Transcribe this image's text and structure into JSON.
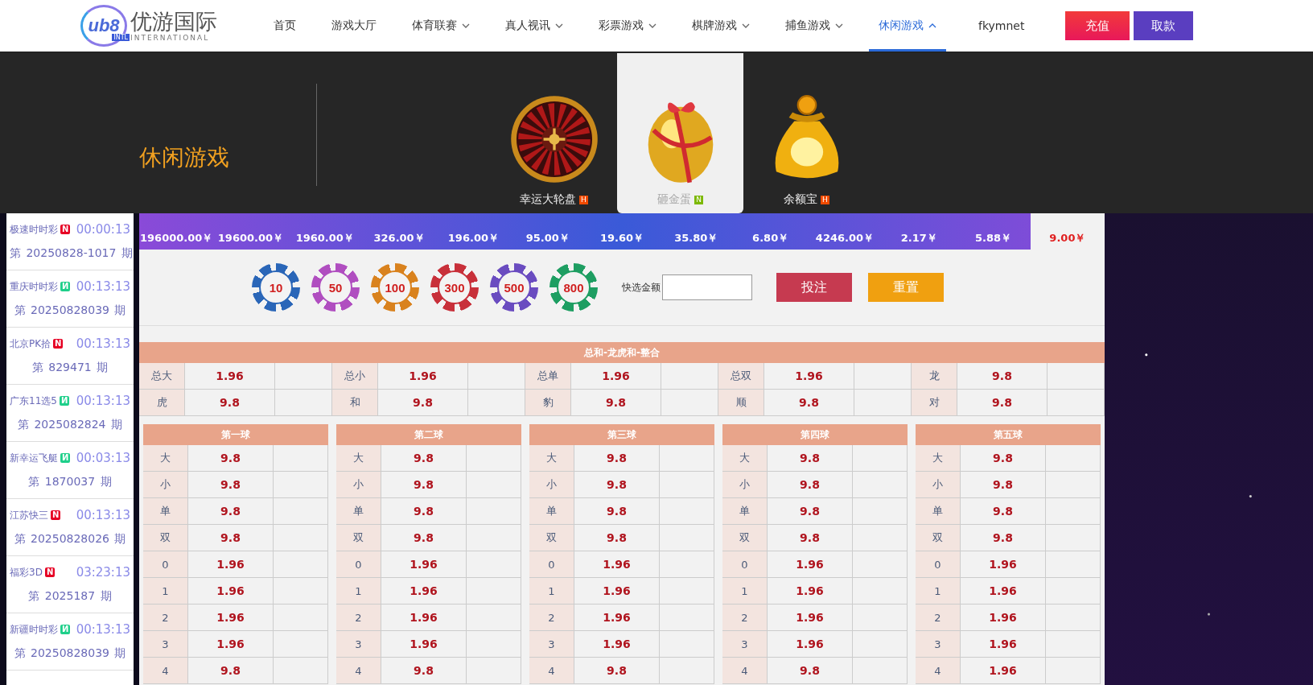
{
  "header": {
    "logo": {
      "mark": "ub8",
      "tag": "INTL",
      "name": "优游国际",
      "sub": "INTERNATIONAL"
    },
    "nav": [
      {
        "label": "首页",
        "dropdown": false,
        "expanded": false,
        "selected": false
      },
      {
        "label": "游戏大厅",
        "dropdown": false,
        "expanded": false,
        "selected": false
      },
      {
        "label": "体育联赛",
        "dropdown": true,
        "expanded": false,
        "selected": false
      },
      {
        "label": "真人视讯",
        "dropdown": true,
        "expanded": false,
        "selected": false
      },
      {
        "label": "彩票游戏",
        "dropdown": true,
        "expanded": false,
        "selected": false
      },
      {
        "label": "棋牌游戏",
        "dropdown": true,
        "expanded": false,
        "selected": false
      },
      {
        "label": "捕鱼游戏",
        "dropdown": true,
        "expanded": false,
        "selected": false
      },
      {
        "label": "休闲游戏",
        "dropdown": true,
        "expanded": true,
        "selected": true
      }
    ],
    "user": "fkymnet",
    "buttons": [
      {
        "label": "充值",
        "kind": "deposit"
      },
      {
        "label": "取款",
        "kind": "withdraw"
      }
    ]
  },
  "dropdown": {
    "title": "休闲游戏",
    "items": [
      {
        "label": "幸运大轮盘",
        "badge": "H",
        "kind": "wheel",
        "selected": false
      },
      {
        "label": "砸金蛋",
        "badge": "N",
        "kind": "egg",
        "selected": true
      },
      {
        "label": "余额宝",
        "badge": "H",
        "kind": "bag",
        "selected": false
      }
    ]
  },
  "sidebar": {
    "items": [
      {
        "name": "极速时时彩",
        "badge": "N",
        "color": "#e60023",
        "time": "00:00:13",
        "issue": "第 20250828-1017 期"
      },
      {
        "name": "重庆时时彩",
        "badge": "И",
        "color": "#1ecf8a",
        "time": "00:13:13",
        "issue": "第 20250828039 期"
      },
      {
        "name": "北京PK拾",
        "badge": "N",
        "color": "#e60023",
        "time": "00:13:13",
        "issue": "第 829471 期"
      },
      {
        "name": "广东11选5",
        "badge": "И",
        "color": "#1ecf8a",
        "time": "00:13:13",
        "issue": "第 2025082824 期"
      },
      {
        "name": "新幸运飞艇",
        "badge": "И",
        "color": "#1ecf8a",
        "time": "00:03:13",
        "issue": "第 1870037 期"
      },
      {
        "name": "江苏快三",
        "badge": "N",
        "color": "#e60023",
        "time": "00:13:13",
        "issue": "第 20250828026 期"
      },
      {
        "name": "福彩3D",
        "badge": "N",
        "color": "#e60023",
        "time": "03:23:13",
        "issue": "第 2025187 期"
      },
      {
        "name": "新疆时时彩",
        "badge": "И",
        "color": "#1ecf8a",
        "time": "00:13:13",
        "issue": "第 20250828039 期"
      }
    ]
  },
  "prizes": [
    {
      "value": "196000.00￥",
      "selected": false
    },
    {
      "value": "19600.00￥",
      "selected": false
    },
    {
      "value": "1960.00￥",
      "selected": false
    },
    {
      "value": "326.00￥",
      "selected": false
    },
    {
      "value": "196.00￥",
      "selected": false
    },
    {
      "value": "95.00￥",
      "selected": false
    },
    {
      "value": "19.60￥",
      "selected": false
    },
    {
      "value": "35.80￥",
      "selected": false
    },
    {
      "value": "6.80￥",
      "selected": false
    },
    {
      "value": "4246.00￥",
      "selected": false
    },
    {
      "value": "2.17￥",
      "selected": false
    },
    {
      "value": "5.88￥",
      "selected": false
    },
    {
      "value": "9.00￥",
      "selected": true
    }
  ],
  "chips": [
    {
      "label": "10",
      "color": "#2a66b8"
    },
    {
      "label": "50",
      "color": "#b04ec0"
    },
    {
      "label": "100",
      "color": "#d9821e"
    },
    {
      "label": "300",
      "color": "#c8303a"
    },
    {
      "label": "500",
      "color": "#6a4cc0"
    },
    {
      "label": "800",
      "color": "#1e9e62"
    }
  ],
  "quick_amount": {
    "label": "快选金额"
  },
  "actions": [
    {
      "label": "投注",
      "kind": "bet"
    },
    {
      "label": "重置",
      "kind": "reset"
    }
  ],
  "summary": {
    "title": "总和-龙虎和-整合",
    "rows": [
      [
        {
          "label": "总大",
          "odds": "1.96"
        },
        {
          "label": "总小",
          "odds": "1.96"
        },
        {
          "label": "总单",
          "odds": "1.96"
        },
        {
          "label": "总双",
          "odds": "1.96"
        },
        {
          "label": "龙",
          "odds": "9.8"
        }
      ],
      [
        {
          "label": "虎",
          "odds": "9.8"
        },
        {
          "label": "和",
          "odds": "9.8"
        },
        {
          "label": "豹",
          "odds": "9.8"
        },
        {
          "label": "顺",
          "odds": "9.8"
        },
        {
          "label": "对",
          "odds": "9.8"
        }
      ]
    ]
  },
  "balls": [
    {
      "title": "第一球",
      "rows": [
        {
          "label": "大",
          "odds": "9.8"
        },
        {
          "label": "小",
          "odds": "9.8"
        },
        {
          "label": "单",
          "odds": "9.8"
        },
        {
          "label": "双",
          "odds": "9.8"
        },
        {
          "label": "0",
          "odds": "1.96"
        },
        {
          "label": "1",
          "odds": "1.96"
        },
        {
          "label": "2",
          "odds": "1.96"
        },
        {
          "label": "3",
          "odds": "1.96"
        },
        {
          "label": "4",
          "odds": "9.8"
        }
      ]
    },
    {
      "title": "第二球",
      "rows": [
        {
          "label": "大",
          "odds": "9.8"
        },
        {
          "label": "小",
          "odds": "9.8"
        },
        {
          "label": "单",
          "odds": "9.8"
        },
        {
          "label": "双",
          "odds": "9.8"
        },
        {
          "label": "0",
          "odds": "1.96"
        },
        {
          "label": "1",
          "odds": "1.96"
        },
        {
          "label": "2",
          "odds": "1.96"
        },
        {
          "label": "3",
          "odds": "1.96"
        },
        {
          "label": "4",
          "odds": "9.8"
        }
      ]
    },
    {
      "title": "第三球",
      "rows": [
        {
          "label": "大",
          "odds": "9.8"
        },
        {
          "label": "小",
          "odds": "9.8"
        },
        {
          "label": "单",
          "odds": "9.8"
        },
        {
          "label": "双",
          "odds": "9.8"
        },
        {
          "label": "0",
          "odds": "1.96"
        },
        {
          "label": "1",
          "odds": "1.96"
        },
        {
          "label": "2",
          "odds": "1.96"
        },
        {
          "label": "3",
          "odds": "1.96"
        },
        {
          "label": "4",
          "odds": "9.8"
        }
      ]
    },
    {
      "title": "第四球",
      "rows": [
        {
          "label": "大",
          "odds": "9.8"
        },
        {
          "label": "小",
          "odds": "9.8"
        },
        {
          "label": "单",
          "odds": "9.8"
        },
        {
          "label": "双",
          "odds": "9.8"
        },
        {
          "label": "0",
          "odds": "1.96"
        },
        {
          "label": "1",
          "odds": "1.96"
        },
        {
          "label": "2",
          "odds": "1.96"
        },
        {
          "label": "3",
          "odds": "1.96"
        },
        {
          "label": "4",
          "odds": "9.8"
        }
      ]
    },
    {
      "title": "第五球",
      "rows": [
        {
          "label": "大",
          "odds": "9.8"
        },
        {
          "label": "小",
          "odds": "9.8"
        },
        {
          "label": "单",
          "odds": "9.8"
        },
        {
          "label": "双",
          "odds": "9.8"
        },
        {
          "label": "0",
          "odds": "1.96"
        },
        {
          "label": "1",
          "odds": "1.96"
        },
        {
          "label": "2",
          "odds": "1.96"
        },
        {
          "label": "3",
          "odds": "1.96"
        },
        {
          "label": "4",
          "odds": "1.96"
        }
      ]
    }
  ]
}
